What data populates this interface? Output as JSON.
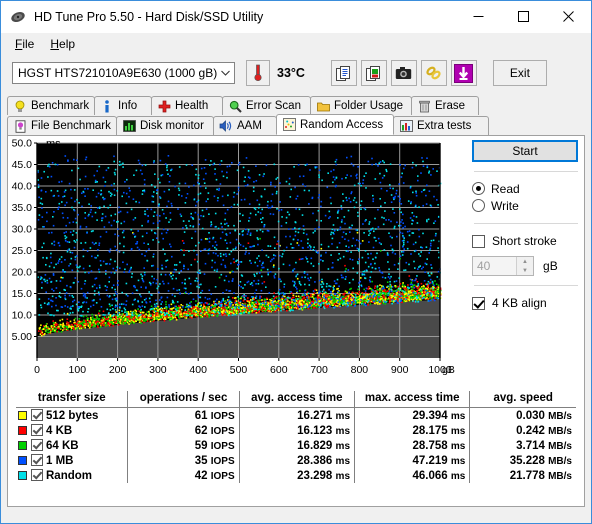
{
  "window": {
    "title": "HD Tune Pro 5.50 - Hard Disk/SSD Utility",
    "app_icon": "hard-disk-icon",
    "minimize": "—",
    "maximize": "☐",
    "close": "✕"
  },
  "menu": [
    {
      "label": "File",
      "mnemonic": "F"
    },
    {
      "label": "Help",
      "mnemonic": "H"
    }
  ],
  "toolbar": {
    "drive": "HGST HTS721010A9E630 (1000 gB)",
    "dropdown_icon": "chevron-down-icon",
    "temperature_icon": "thermometer-icon",
    "temperature": "33°C",
    "buttons": [
      {
        "name": "copy-text-icon"
      },
      {
        "name": "copy-image-icon"
      },
      {
        "name": "camera-icon"
      },
      {
        "name": "chain-icon"
      },
      {
        "name": "save-down-arrow-icon"
      }
    ],
    "exit_label": "Exit"
  },
  "tabs": {
    "row1": [
      {
        "label": "Benchmark",
        "icon": "lightbulb-icon",
        "active": false
      },
      {
        "label": "Info",
        "icon": "info-icon",
        "active": false
      },
      {
        "label": "Health",
        "icon": "red-cross-icon",
        "active": false
      },
      {
        "label": "Error Scan",
        "icon": "magnifier-icon",
        "active": false
      },
      {
        "label": "Folder Usage",
        "icon": "folder-icon",
        "active": false
      },
      {
        "label": "Erase",
        "icon": "trash-icon",
        "active": false
      }
    ],
    "row2": [
      {
        "label": "File Benchmark",
        "icon": "file-lightbulb-icon",
        "active": false
      },
      {
        "label": "Disk monitor",
        "icon": "bar-chart-icon",
        "active": false
      },
      {
        "label": "AAM",
        "icon": "speaker-icon",
        "active": false
      },
      {
        "label": "Random Access",
        "icon": "scatter-dots-icon",
        "active": true
      },
      {
        "label": "Extra tests",
        "icon": "chart-grid-icon",
        "active": false
      }
    ]
  },
  "controls": {
    "start_label": "Start",
    "mode": [
      {
        "label": "Read",
        "selected": true
      },
      {
        "label": "Write",
        "selected": false
      }
    ],
    "short_stroke": {
      "label": "Short stroke",
      "checked": false
    },
    "short_stroke_value": "40",
    "short_stroke_unit": "gB",
    "short_stroke_unit_mnemonic": "g",
    "align": {
      "label": "4 KB align",
      "checked": true
    }
  },
  "table": {
    "headers": [
      "transfer size",
      "operations / sec",
      "avg. access time",
      "max. access time",
      "avg. speed"
    ],
    "rows": [
      {
        "color": "#ffff00",
        "checked": true,
        "size": "512 bytes",
        "iops": "61 IOPS",
        "avg_access": "16.271 ms",
        "max_access": "29.394 ms",
        "avg_speed": "0.030 MB/s"
      },
      {
        "color": "#ff0000",
        "checked": true,
        "size": "4 KB",
        "iops": "62 IOPS",
        "avg_access": "16.123 ms",
        "max_access": "28.175 ms",
        "avg_speed": "0.242 MB/s"
      },
      {
        "color": "#00d000",
        "checked": true,
        "size": "64 KB",
        "iops": "59 IOPS",
        "avg_access": "16.829 ms",
        "max_access": "28.758 ms",
        "avg_speed": "3.714 MB/s"
      },
      {
        "color": "#0050ff",
        "checked": true,
        "size": "1 MB",
        "iops": "35 IOPS",
        "avg_access": "28.386 ms",
        "max_access": "47.219 ms",
        "avg_speed": "35.228 MB/s"
      },
      {
        "color": "#00e0e8",
        "checked": true,
        "size": "Random",
        "iops": "42 IOPS",
        "avg_access": "23.298 ms",
        "max_access": "46.066 ms",
        "avg_speed": "21.778 MB/s"
      }
    ]
  },
  "chart_data": {
    "type": "scatter",
    "title": "",
    "xlabel": "gB",
    "ylabel": "ms",
    "xlim": [
      0,
      1000
    ],
    "ylim": [
      0,
      50
    ],
    "xticks": [
      0,
      100,
      200,
      300,
      400,
      500,
      600,
      700,
      800,
      900,
      1000
    ],
    "yticks": [
      5.0,
      10.0,
      15.0,
      20.0,
      25.0,
      30.0,
      35.0,
      40.0,
      45.0,
      50.0
    ],
    "ytick_labels": [
      "5.00",
      "10.0",
      "15.0",
      "20.0",
      "25.0",
      "30.0",
      "35.0",
      "40.0",
      "45.0",
      "50.0"
    ],
    "grid": true,
    "plot_bg": "#000000",
    "grid_color": "#9a9a9a",
    "outside_bg": "#4a4a4a",
    "legend_position": "below-as-table",
    "series": [
      {
        "name": "512 bytes",
        "color": "#ffff00",
        "n_points": 1400,
        "access_band_ms": [
          6,
          17
        ],
        "avg_access_ms": 16.271,
        "max_access_ms": 29.394
      },
      {
        "name": "4 KB",
        "color": "#ff0000",
        "n_points": 1400,
        "access_band_ms": [
          6,
          17
        ],
        "avg_access_ms": 16.123,
        "max_access_ms": 28.175
      },
      {
        "name": "64 KB",
        "color": "#00d000",
        "n_points": 1400,
        "access_band_ms": [
          6,
          18
        ],
        "avg_access_ms": 16.829,
        "max_access_ms": 28.758
      },
      {
        "name": "1 MB",
        "color": "#0050ff",
        "n_points": 900,
        "access_band_ms": [
          12,
          40
        ],
        "avg_access_ms": 28.386,
        "max_access_ms": 47.219
      },
      {
        "name": "Random",
        "color": "#00e0e8",
        "n_points": 900,
        "access_band_ms": [
          10,
          38
        ],
        "avg_access_ms": 23.298,
        "max_access_ms": 46.066
      }
    ],
    "note": "Access time rises with disk position; dense low-latency cluster of 512B/4KB/64KB near 6-18 ms, sparse 1MB/Random points spread 12-45 ms."
  }
}
